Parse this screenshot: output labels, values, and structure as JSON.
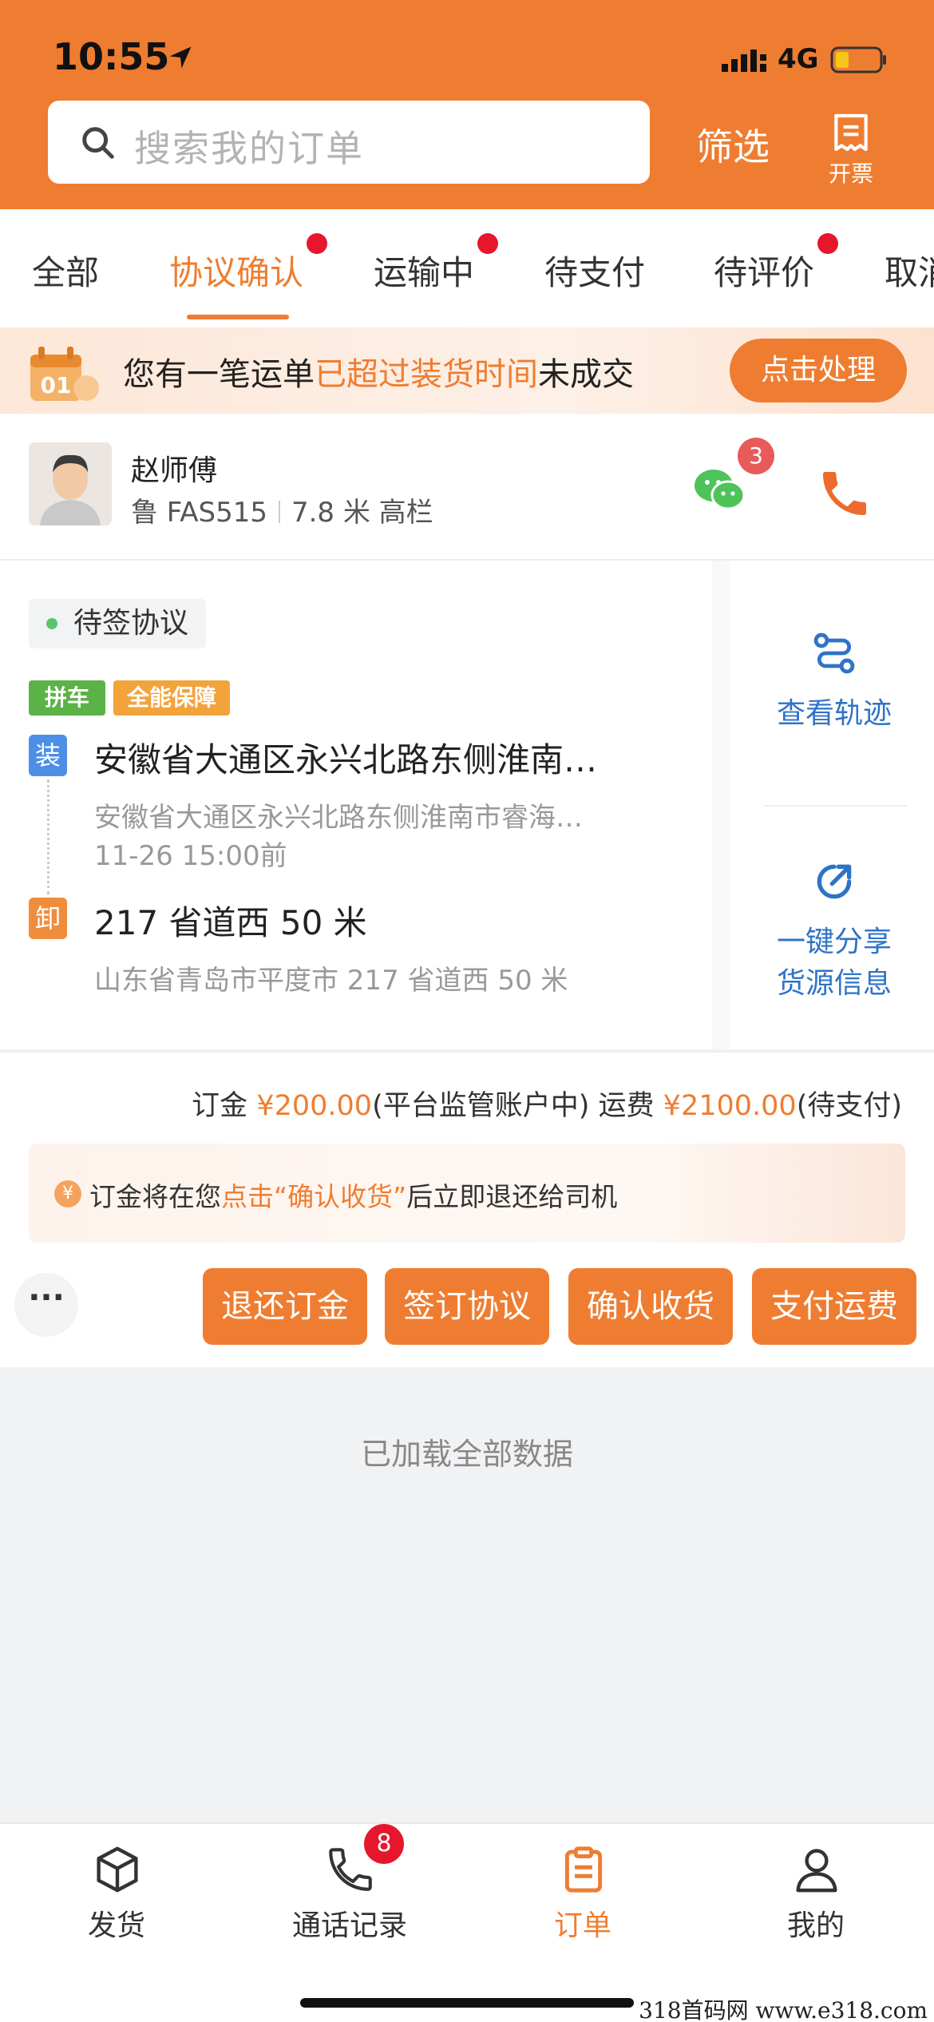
{
  "status_bar": {
    "time": "10:55",
    "network": "4G"
  },
  "search": {
    "placeholder": "搜索我的订单"
  },
  "header": {
    "filter_label": "筛选",
    "invoice_label": "开票"
  },
  "tabs": [
    {
      "label": "全部",
      "dot": false
    },
    {
      "label": "协议确认",
      "dot": true,
      "active": true
    },
    {
      "label": "运输中",
      "dot": true
    },
    {
      "label": "待支付",
      "dot": false
    },
    {
      "label": "待评价",
      "dot": true
    },
    {
      "label": "取消",
      "dot": false
    }
  ],
  "banner": {
    "text_prefix": "您有一笔运单",
    "text_highlight": "已超过装货时间",
    "text_suffix": "未成交",
    "button_label": "点击处理"
  },
  "driver": {
    "name": "赵师傅",
    "plate": "鲁 FAS515",
    "truck": "7.8 米 高栏",
    "chat_unread": "3"
  },
  "order": {
    "status": "待签协议",
    "tags": [
      "拼车",
      "全能保障"
    ],
    "load_mark": "装",
    "load_title": "安徽省大通区永兴北路东侧淮南…",
    "load_address": "安徽省大通区永兴北路东侧淮南市睿海…",
    "load_time": "11-26 15:00前",
    "unload_mark": "卸",
    "unload_title": "217 省道西 50 米",
    "unload_address": "山东省青岛市平度市 217 省道西 50 米",
    "track_label": "查看轨迹",
    "share_label_1": "一键分享",
    "share_label_2": "货源信息"
  },
  "fees": {
    "deposit_label": "订金",
    "deposit_amount": "¥200.00",
    "deposit_note": "(平台监管账户中)",
    "freight_label": "运费",
    "freight_amount": "¥2100.00",
    "freight_note": "(待支付)"
  },
  "notice": {
    "icon": "¥",
    "prefix": "订金将在您",
    "highlight": "点击“确认收货”",
    "suffix": "后立即退还给司机"
  },
  "actions": {
    "more": "···",
    "refund_deposit": "退还订金",
    "sign_agreement": "签订协议",
    "confirm_receipt": "确认收货",
    "pay_freight": "支付运费"
  },
  "list_end": "已加载全部数据",
  "bottom_nav": [
    {
      "label": "发货",
      "icon": "box-icon"
    },
    {
      "label": "通话记录",
      "icon": "phone-log-icon",
      "badge": "8"
    },
    {
      "label": "订单",
      "icon": "clipboard-icon",
      "active": true
    },
    {
      "label": "我的",
      "icon": "user-icon"
    }
  ],
  "watermark": "318首码网  www.e318.com",
  "colors": {
    "brand": "#ef7d31",
    "badge_red": "#e6162d",
    "link_blue": "#2f73c7"
  }
}
